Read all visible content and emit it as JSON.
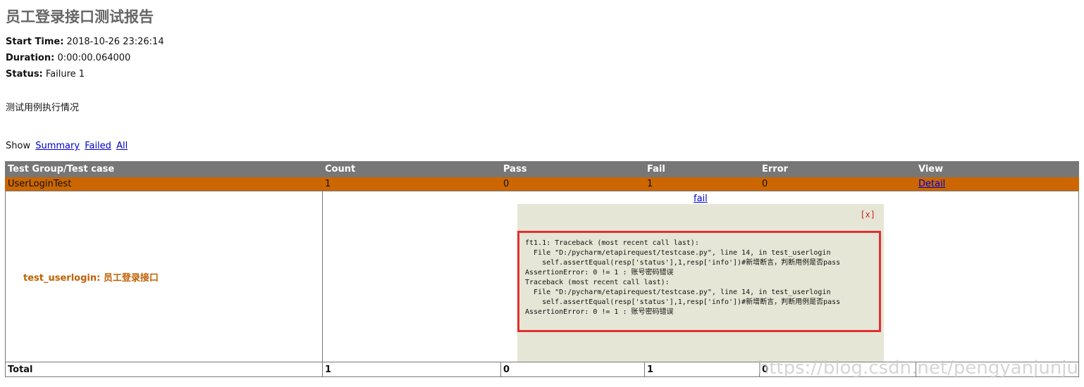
{
  "report": {
    "title": "员工登录接口测试报告",
    "start_time_label": "Start Time:",
    "start_time": "2018-10-26 23:26:14",
    "duration_label": "Duration:",
    "duration": "0:00:00.064000",
    "status_label": "Status:",
    "status": "Failure 1",
    "description": "测试用例执行情况"
  },
  "filter": {
    "prefix": "Show",
    "summary": "Summary",
    "failed": "Failed",
    "all": "All"
  },
  "table": {
    "headers": [
      "Test Group/Test case",
      "Count",
      "Pass",
      "Fail",
      "Error",
      "View"
    ],
    "group": {
      "name": "UserLoginTest",
      "count": "1",
      "pass": "0",
      "fail": "1",
      "error": "0",
      "view": "Detail"
    },
    "case": {
      "name": "test_userlogin: 员工登录接口",
      "status_link": "fail",
      "close": "[x]",
      "traceback": "ft1.1: Traceback (most recent call last):\n  File \"D:/pycharm/etapirequest/testcase.py\", line 14, in test_userlogin\n    self.assertEqual(resp['status'],1,resp['info'])#新增断言，判断用例是否pass\nAssertionError: 0 != 1 : 账号密码错误\nTraceback (most recent call last):\n  File \"D:/pycharm/etapirequest/testcase.py\", line 14, in test_userlogin\n    self.assertEqual(resp['status'],1,resp['info'])#新增断言，判断用例是否pass\nAssertionError: 0 != 1 : 账号密码错误"
    },
    "total": {
      "label": "Total",
      "count": "1",
      "pass": "0",
      "fail": "1",
      "error": "0"
    }
  },
  "watermark": "https://blog.csdn.net/pengyanjunju"
}
